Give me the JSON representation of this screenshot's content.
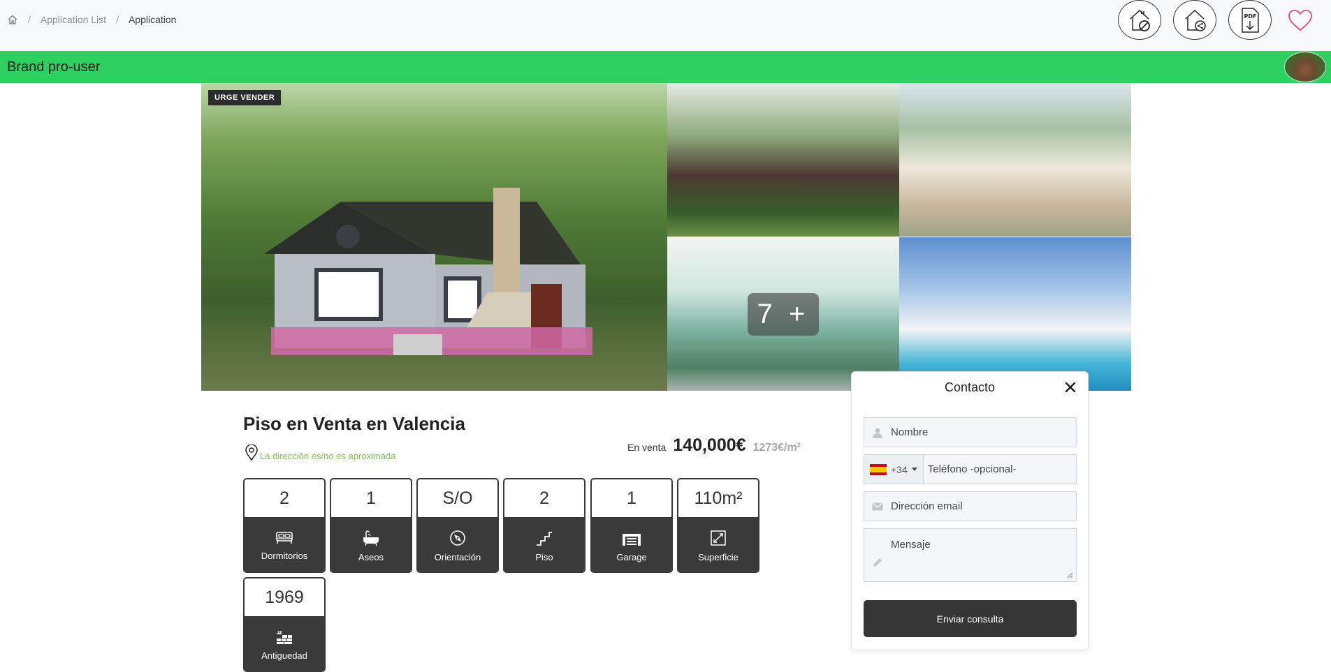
{
  "breadcrumb": {
    "items": [
      "Application List",
      "Application"
    ],
    "separator": "/"
  },
  "top_actions": [
    "house-cancel-icon",
    "house-share-icon",
    "pdf-download-icon",
    "heart-icon"
  ],
  "brand": {
    "name": "Brand pro-user"
  },
  "gallery": {
    "badge": "URGE VENDER",
    "more_label": "7 +"
  },
  "listing": {
    "title": "Piso en Venta en Valencia",
    "address": "La dirección es/no es aproximada",
    "price_label": "En venta",
    "price": "140,000€",
    "price_per_sqm": "1273€/m²"
  },
  "features": [
    {
      "value": "2",
      "label": "Dormitorios",
      "icon": "bed-icon"
    },
    {
      "value": "1",
      "label": "Aseos",
      "icon": "bathtub-icon"
    },
    {
      "value": "S/O",
      "label": "Orientación",
      "icon": "compass-icon"
    },
    {
      "value": "2",
      "label": "Piso",
      "icon": "stairs-icon"
    },
    {
      "value": "1",
      "label": "Garage",
      "icon": "garage-icon"
    },
    {
      "value": "110m²",
      "label": "Superficie",
      "icon": "expand-icon"
    },
    {
      "value": "1969",
      "label": "Antiguedad",
      "icon": "brick-wall-icon"
    }
  ],
  "contact": {
    "title": "Contacto",
    "name_placeholder": "Nombre",
    "phone_prefix": "+34",
    "phone_placeholder": "Teléfono -opcional-",
    "email_placeholder": "Dirección email",
    "message_placeholder": "Mensaje",
    "submit_label": "Enviar consulta"
  },
  "colors": {
    "brand_green": "#2ed160",
    "tile_dark": "#3a3a3a",
    "address_green": "#7dc04d",
    "heart_pink": "#e8447a"
  }
}
